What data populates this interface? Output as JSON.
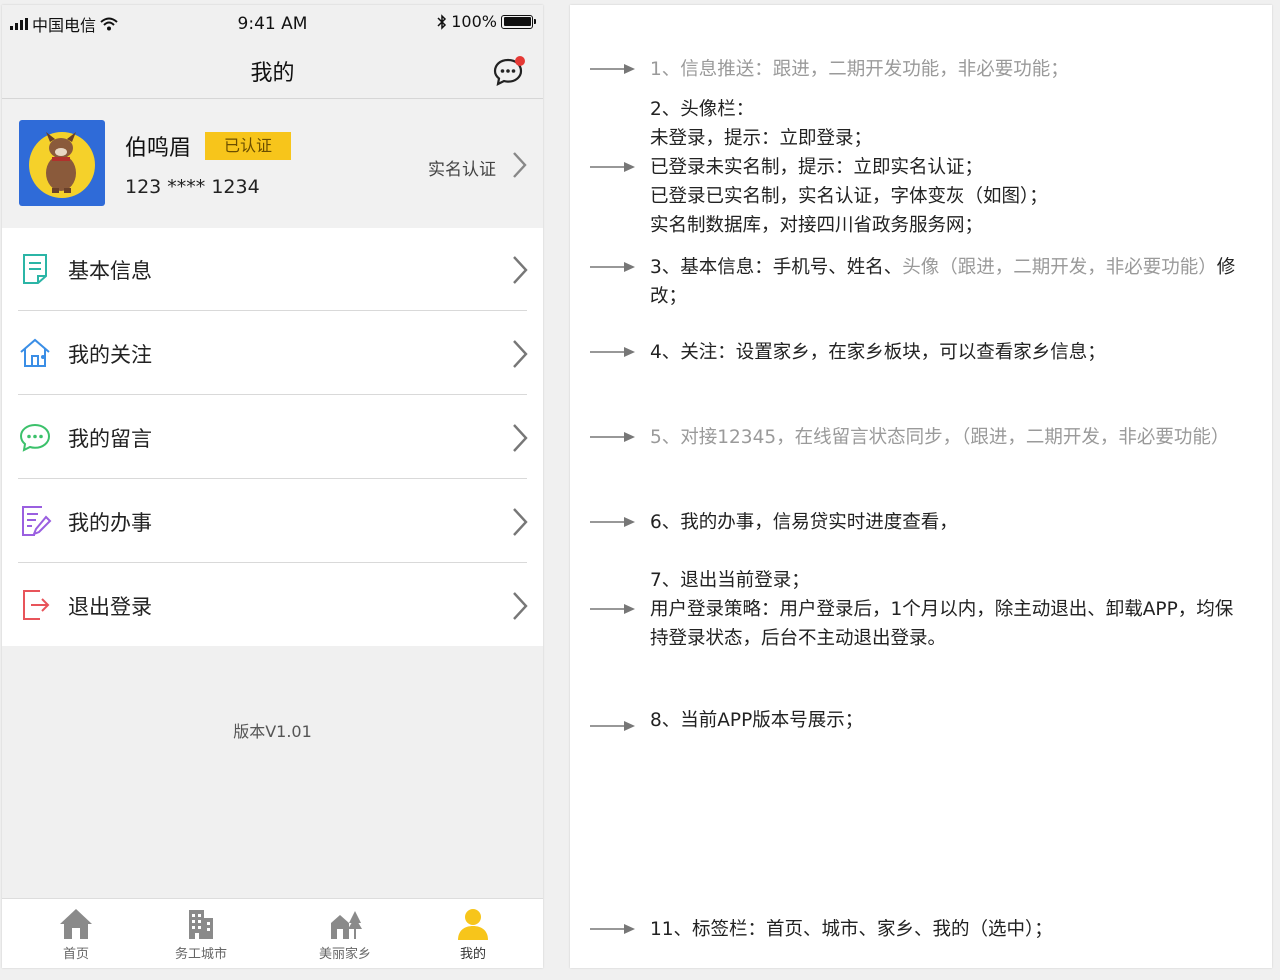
{
  "status_bar": {
    "carrier": "中国电信",
    "time": "9:41 AM",
    "battery": "100%"
  },
  "nav": {
    "title": "我的"
  },
  "profile": {
    "name": "伯鸣眉",
    "badge": "已认证",
    "phone": "123 ****  1234",
    "verify_label": "实名认证"
  },
  "menu": [
    {
      "label": "基本信息",
      "icon": "document-icon",
      "color": "#2bb5a6"
    },
    {
      "label": "我的关注",
      "icon": "house-icon",
      "color": "#3a8ee6"
    },
    {
      "label": "我的留言",
      "icon": "chat-icon",
      "color": "#3cc16b"
    },
    {
      "label": "我的办事",
      "icon": "edit-list-icon",
      "color": "#9a5fe0"
    },
    {
      "label": "退出登录",
      "icon": "logout-icon",
      "color": "#e8545a"
    }
  ],
  "version": "版本V1.01",
  "tabs": [
    {
      "label": "首页",
      "icon": "home-icon"
    },
    {
      "label": "务工城市",
      "icon": "building-icon"
    },
    {
      "label": "美丽家乡",
      "icon": "village-icon"
    },
    {
      "label": "我的",
      "icon": "user-icon",
      "selected": true
    }
  ],
  "notes": {
    "n1": "1、信息推送：跟进，二期开发功能，非必要功能；",
    "n2": {
      "l1": "2、头像栏：",
      "l2": "未登录，提示：立即登录；",
      "l3": "已登录未实名制，提示：立即实名认证；",
      "l4": "已登录已实名制，实名认证，字体变灰（如图）；",
      "l5": "实名制数据库，对接四川省政务服务网；"
    },
    "n3": {
      "a": "3、基本信息：手机号、姓名、",
      "b": "头像（跟进，二期开发，非必要功能）",
      "c": "修改；"
    },
    "n4": "4、关注：设置家乡，在家乡板块，可以查看家乡信息；",
    "n5": "5、对接12345，在线留言状态同步，（跟进，二期开发，非必要功能）",
    "n6": "6、我的办事，信易贷实时进度查看，",
    "n7": {
      "l1": "7、退出当前登录；",
      "l2": "用户登录策略：用户登录后，1个月以内，除主动退出、卸载APP，均保持登录状态，后台不主动退出登录。"
    },
    "n8": "8、当前APP版本号展示；",
    "n11": "11、标签栏：首页、城市、家乡、我的（选中）；"
  },
  "colors": {
    "accent_yellow": "#f7c51b",
    "notification_dot": "#e53935"
  }
}
